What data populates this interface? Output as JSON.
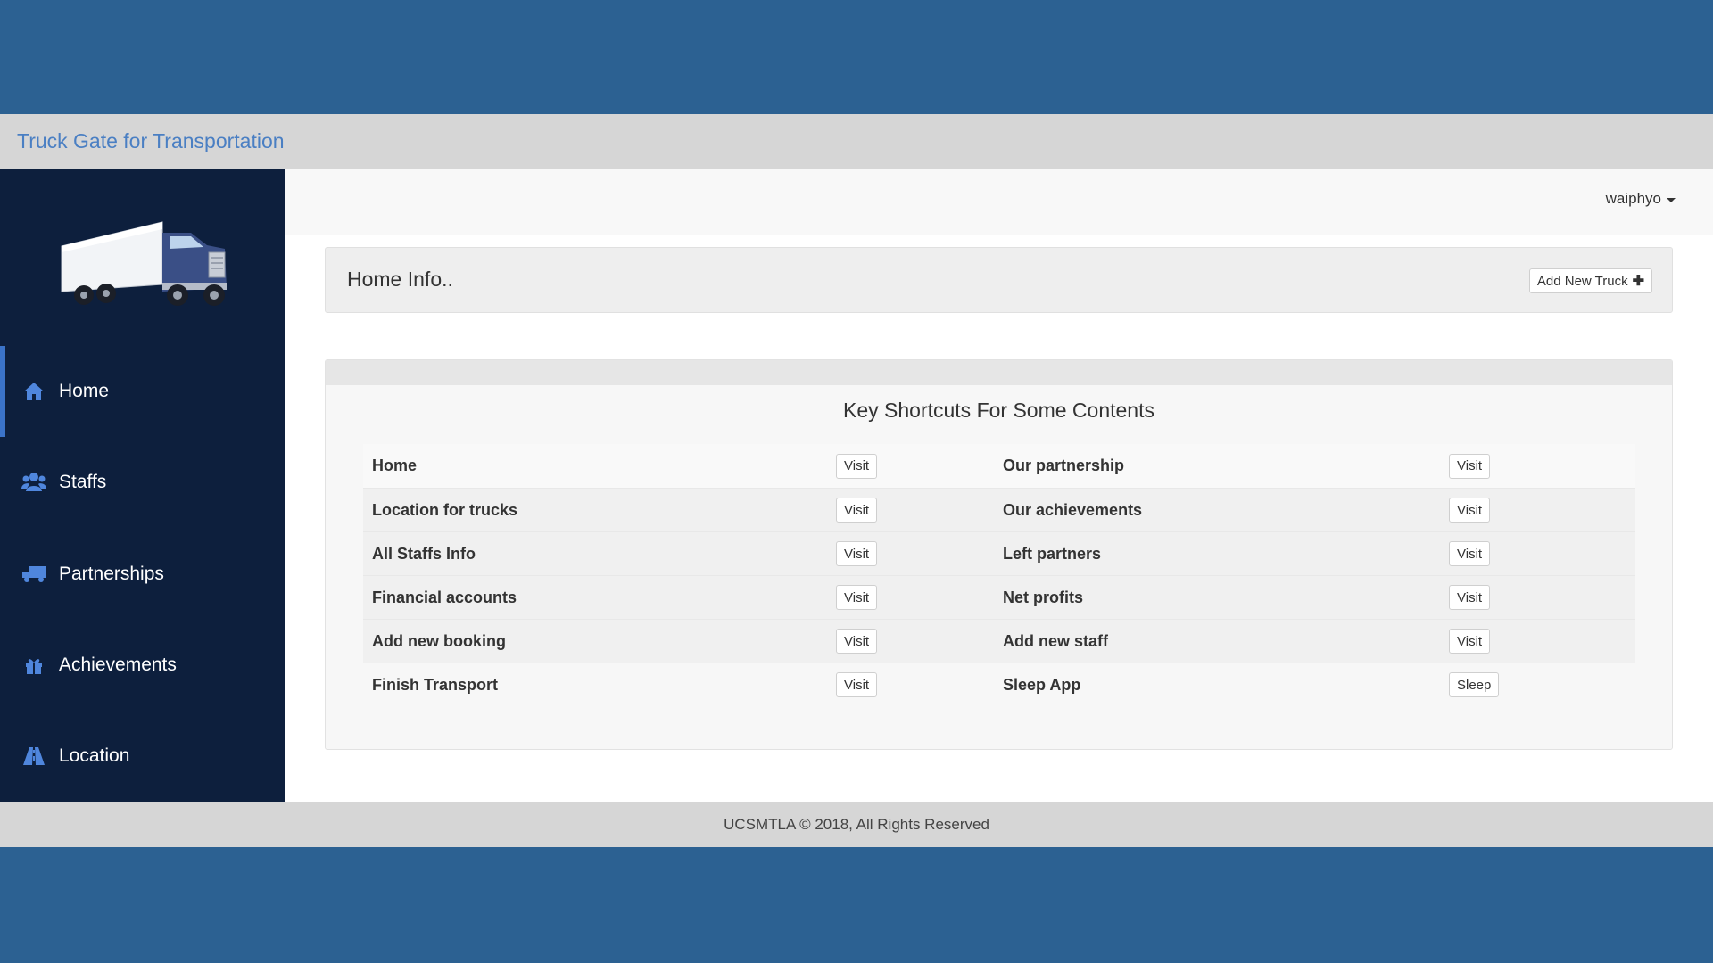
{
  "brand": {
    "title": "Truck Gate for Transportation"
  },
  "sidebar": {
    "logo_alt": "truck",
    "items": [
      {
        "label": "Home",
        "icon": "home-icon"
      },
      {
        "label": "Staffs",
        "icon": "users-icon"
      },
      {
        "label": "Partnerships",
        "icon": "truck-icon"
      },
      {
        "label": "Achievements",
        "icon": "gift-icon"
      },
      {
        "label": "Location",
        "icon": "road-icon"
      }
    ],
    "active": "Home"
  },
  "topbar": {
    "user": "waiphyo"
  },
  "header_panel": {
    "title": "Home Info..",
    "add_button": "Add New Truck"
  },
  "shortcuts": {
    "title": "Key Shortcuts For Some Contents",
    "rows": [
      {
        "left_label": "Home",
        "left_button": "Visit",
        "right_label": "Our partnership",
        "right_button": "Visit"
      },
      {
        "left_label": "Location for trucks",
        "left_button": "Visit",
        "right_label": "Our achievements",
        "right_button": "Visit"
      },
      {
        "left_label": "All Staffs Info",
        "left_button": "Visit",
        "right_label": "Left partners",
        "right_button": "Visit"
      },
      {
        "left_label": "Financial accounts",
        "left_button": "Visit",
        "right_label": "Net profits",
        "right_button": "Visit"
      },
      {
        "left_label": "Add new booking",
        "left_button": "Visit",
        "right_label": "Add new staff",
        "right_button": "Visit"
      },
      {
        "left_label": "Finish Transport",
        "left_button": "Visit",
        "right_label": "Sleep App",
        "right_button": "Sleep"
      }
    ]
  },
  "footer": {
    "text": "UCSMTLA © 2018, All Rights Reserved"
  },
  "colors": {
    "page_bg": "#2c6192",
    "sidebar_bg": "#0d1f3d",
    "brand_text": "#4a7fc3",
    "icon_blue": "#4f86dd",
    "active_accent": "#3b73c8"
  }
}
